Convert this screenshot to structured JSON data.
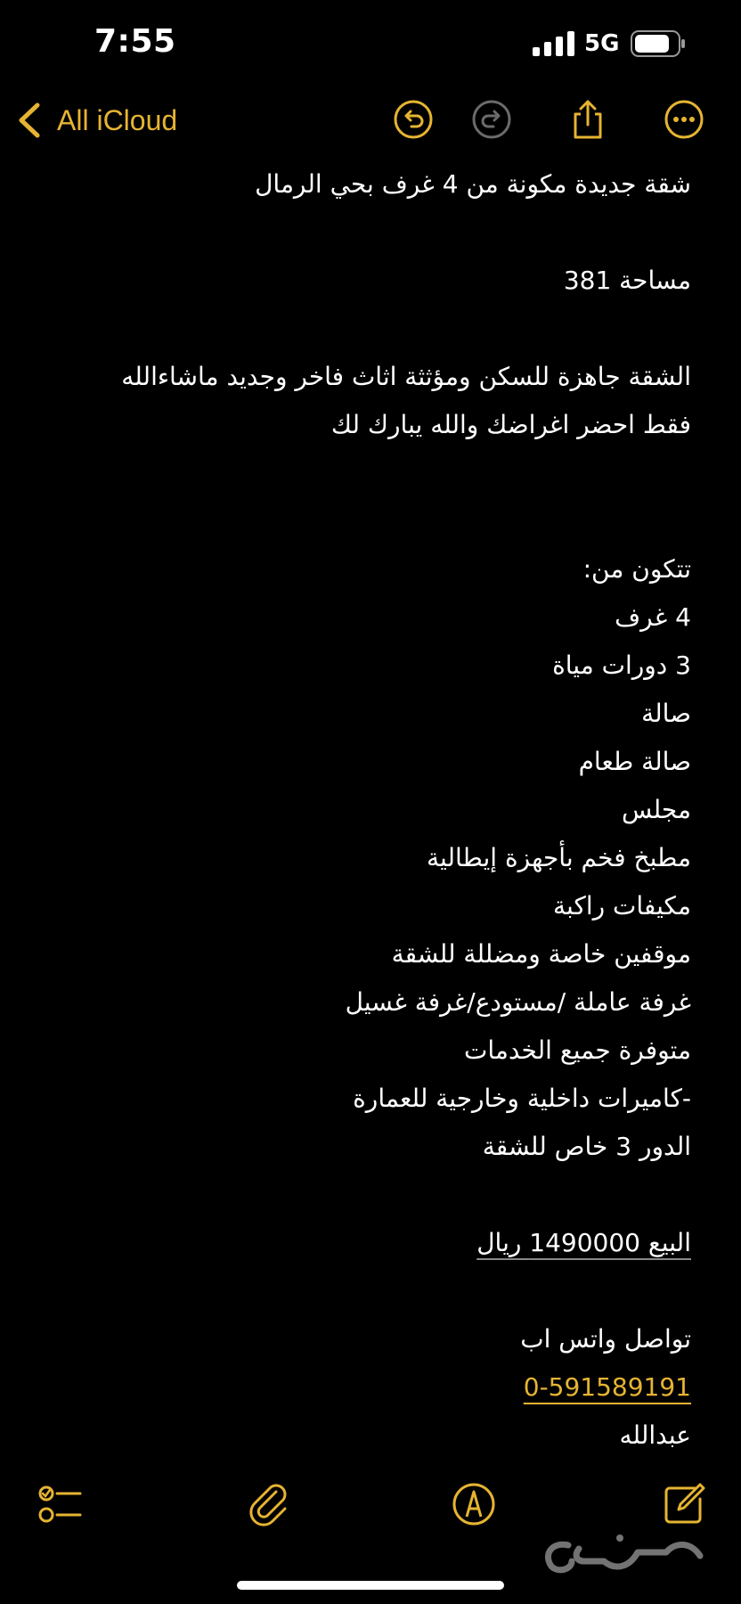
{
  "status_bar": {
    "time": "7:55",
    "network": "5G"
  },
  "nav": {
    "back_label": "All iCloud",
    "icons": [
      "chevron-left-icon",
      "undo-icon",
      "redo-icon",
      "share-icon",
      "more-icon"
    ]
  },
  "note": {
    "lines": [
      "شقة جديدة مكونة من 4 غرف بحي الرمال",
      "",
      "مساحة 381",
      "",
      "الشقة جاهزة للسكن ومؤثثة اثاث فاخر وجديد ماشاءالله",
      "فقط احضر اغراضك والله يبارك لك",
      "",
      "",
      "تتكون من:",
      "4 غرف",
      "3 دورات مياة",
      "صالة",
      "صالة طعام",
      "مجلس",
      "مطبخ  فخم بأجهزة إيطالية",
      "مكيفات راكبة",
      "موقفين خاصة ومضللة للشقة",
      "غرفة عاملة /مستودع/غرفة غسيل",
      "متوفرة جميع الخدمات",
      "-كاميرات داخلية وخارجية للعمارة",
      "الدور 3 خاص للشقة",
      "",
      "البيع 1490000 ريال",
      "",
      "تواصل واتس اب",
      "0-591589191",
      "عبدالله"
    ],
    "phone_link": "0-591589191"
  },
  "toolbar": {
    "icons": [
      "checklist-icon",
      "paperclip-icon",
      "markup-pen-icon",
      "compose-icon"
    ]
  },
  "watermark": {
    "text": "حراج"
  },
  "colors": {
    "background": "#000000",
    "text": "#ffffff",
    "accent": "#e6b432",
    "disabled": "#6b6b6b"
  }
}
